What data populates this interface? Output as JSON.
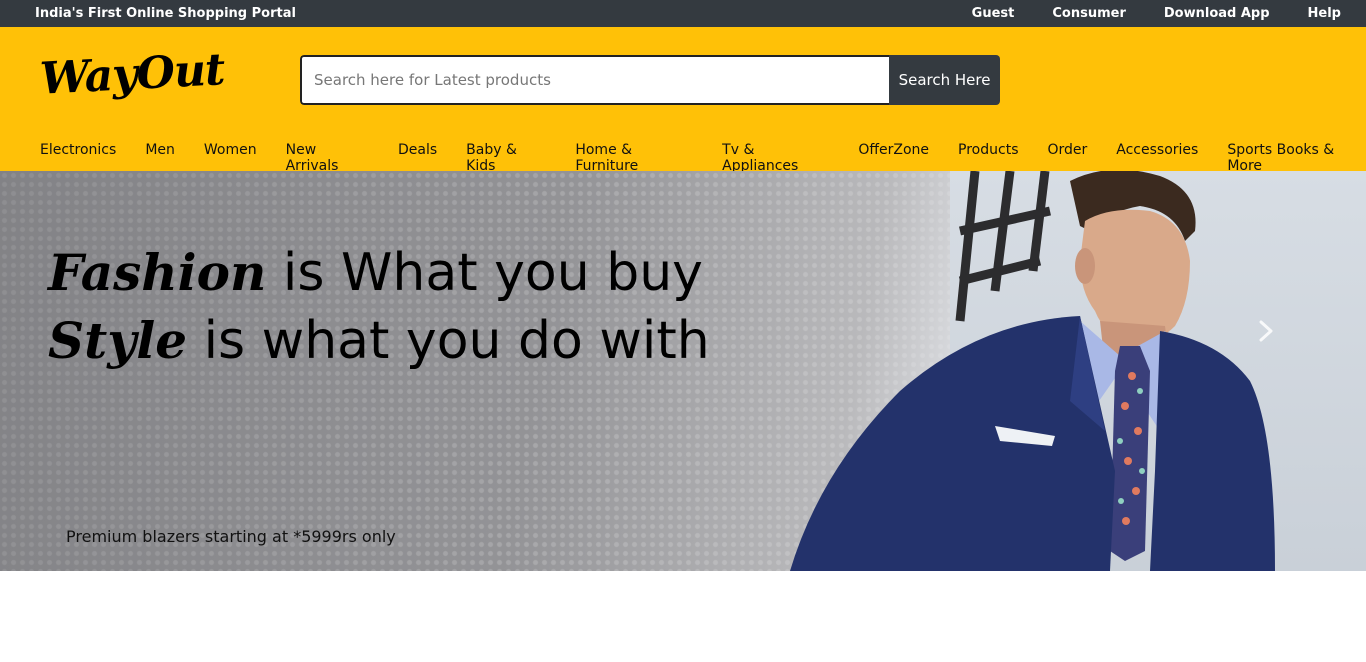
{
  "topbar": {
    "tagline": "India's First Online Shopping Portal",
    "links": [
      "Guest",
      "Consumer",
      "Download App",
      "Help"
    ]
  },
  "header": {
    "logo": "WayOut",
    "search": {
      "placeholder": "Search here for Latest products",
      "value": "",
      "button_label": "Search Here"
    }
  },
  "nav": {
    "items": [
      "Electronics",
      "Men",
      "Women",
      "New Arrivals",
      "Deals",
      "Baby & Kids",
      "Home & Furniture",
      "Tv & Appliances",
      "OfferZone",
      "Products",
      "Order",
      "Accessories",
      "Sports Books & More"
    ]
  },
  "hero": {
    "line1_script": "Fashion",
    "line1_rest": " is What you buy",
    "line2_script": "Style",
    "line2_rest": " is what you do with",
    "caption": "Premium blazers starting at *5999rs only",
    "next_icon": "chevron-right-icon"
  },
  "colors": {
    "topbar": "#343a40",
    "header": "#ffc107",
    "button": "#343a40"
  }
}
